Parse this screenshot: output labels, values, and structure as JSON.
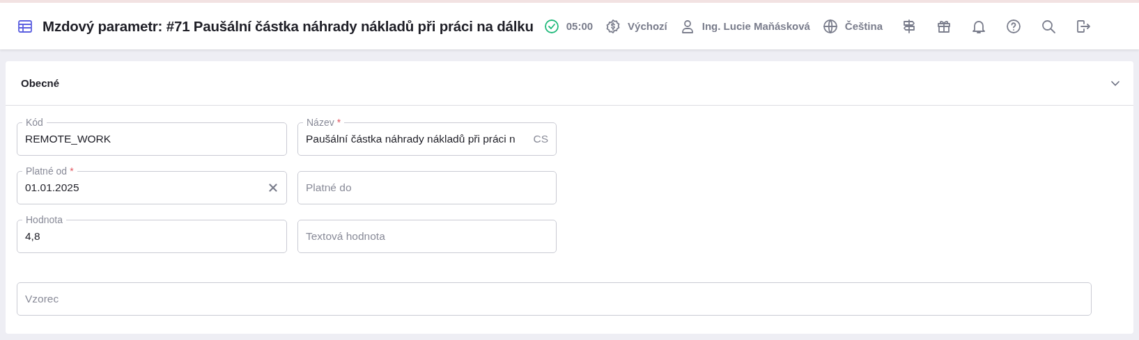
{
  "header": {
    "title": "Mzdový parametr: #71 Paušální částka náhrady nákladů při práci na dálku",
    "items": [
      {
        "kind": "status",
        "text": "05:00"
      },
      {
        "kind": "currency",
        "text": "Výchozí"
      },
      {
        "kind": "user",
        "text": "Ing. Lucie Maňásková"
      },
      {
        "kind": "language",
        "text": "Čeština"
      },
      {
        "kind": "signpost"
      },
      {
        "kind": "gift"
      },
      {
        "kind": "bell"
      },
      {
        "kind": "help"
      },
      {
        "kind": "search"
      },
      {
        "kind": "logout"
      }
    ]
  },
  "section": {
    "title": "Obecné",
    "expanded": true,
    "fields": [
      {
        "label": "Kód",
        "value": "REMOTE_WORK"
      },
      {
        "label": "Název",
        "required_mark": "*",
        "value": "Paušální částka náhrady nákladů při práci n",
        "suffix": "CS"
      },
      {
        "label": "Platné od",
        "required_mark": "*",
        "value": "01.01.2025",
        "clearable": true
      },
      {
        "placeholder": "Platné do"
      },
      {
        "label": "Hodnota",
        "value": "4,8"
      },
      {
        "placeholder": "Textová hodnota"
      },
      {
        "placeholder": "Vzorec",
        "wide": true
      }
    ]
  }
}
